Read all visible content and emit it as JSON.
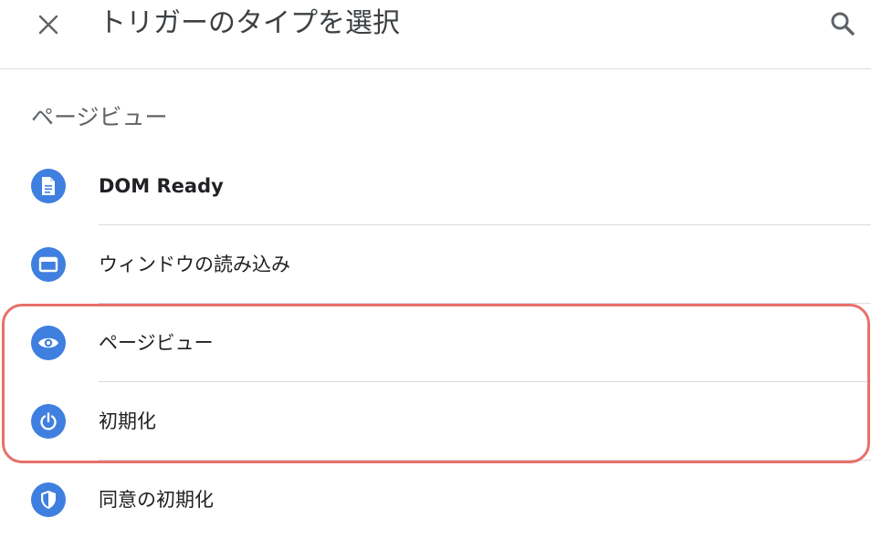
{
  "header": {
    "title": "トリガーのタイプを選択",
    "close_icon": "close-icon",
    "search_icon": "search-icon"
  },
  "section": {
    "title": "ページビュー"
  },
  "items": [
    {
      "label": "DOM Ready",
      "icon": "document-icon",
      "bold": true
    },
    {
      "label": "ウィンドウの読み込み",
      "icon": "window-icon",
      "bold": false
    },
    {
      "label": "ページビュー",
      "icon": "eye-icon",
      "bold": false
    },
    {
      "label": "初期化",
      "icon": "power-icon",
      "bold": false
    },
    {
      "label": "同意の初期化",
      "icon": "shield-icon",
      "bold": false
    }
  ],
  "colors": {
    "icon_background": "#3f7fe0",
    "highlight_border": "#e8706a",
    "divider": "#dadce0"
  }
}
